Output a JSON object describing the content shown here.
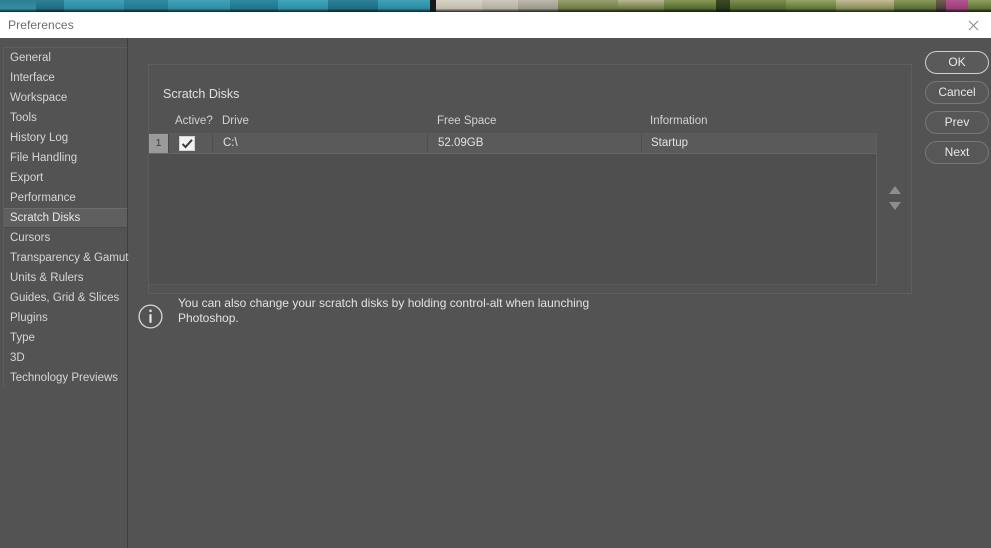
{
  "window": {
    "title": "Preferences",
    "close_icon": "close-x-icon"
  },
  "photo_strip": {
    "description": "photo-thumbnail-strip"
  },
  "sidebar": {
    "items": [
      {
        "label": "General",
        "selected": false
      },
      {
        "label": "Interface",
        "selected": false
      },
      {
        "label": "Workspace",
        "selected": false
      },
      {
        "label": "Tools",
        "selected": false
      },
      {
        "label": "History Log",
        "selected": false
      },
      {
        "label": "File Handling",
        "selected": false
      },
      {
        "label": "Export",
        "selected": false
      },
      {
        "label": "Performance",
        "selected": false
      },
      {
        "label": "Scratch Disks",
        "selected": true
      },
      {
        "label": "Cursors",
        "selected": false
      },
      {
        "label": "Transparency & Gamut",
        "selected": false
      },
      {
        "label": "Units & Rulers",
        "selected": false
      },
      {
        "label": "Guides, Grid & Slices",
        "selected": false
      },
      {
        "label": "Plugins",
        "selected": false
      },
      {
        "label": "Type",
        "selected": false
      },
      {
        "label": "3D",
        "selected": false
      },
      {
        "label": "Technology Previews",
        "selected": false
      }
    ]
  },
  "main": {
    "group_title": "Scratch Disks",
    "table": {
      "columns": [
        "Active?",
        "Drive",
        "Free Space",
        "Information"
      ],
      "rows": [
        {
          "number": "1",
          "active": true,
          "drive": "C:\\",
          "free_space": "52.09GB",
          "information": "Startup"
        }
      ]
    },
    "reorder": {
      "up_icon": "arrow-up-icon",
      "down_icon": "arrow-down-icon"
    },
    "note": {
      "icon": "info-circle-icon",
      "text": "You can also change your scratch disks by holding control-alt when launching Photoshop."
    }
  },
  "buttons": [
    {
      "label": "OK",
      "primary": true
    },
    {
      "label": "Cancel",
      "primary": false
    },
    {
      "label": "Prev",
      "primary": false
    },
    {
      "label": "Next",
      "primary": false
    }
  ],
  "colors": {
    "dialog_bg": "#535353",
    "titlebar_bg": "#ffffff",
    "row_bg": "#5a5a5a",
    "selected_item_bg": "#5f5f5f",
    "text": "#e2e2e2"
  }
}
